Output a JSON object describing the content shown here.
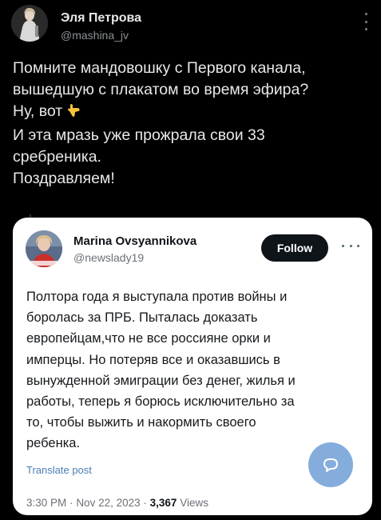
{
  "author": {
    "name": "Эля Петрова",
    "handle": "@mashina_jv"
  },
  "post": {
    "lines": [
      "Помните мандовошку с Первого канала,",
      "вышедшую с плакатом во время эфира?",
      "Ну, вот",
      "И эта мразь уже прожрала свои 33",
      "сребреника.",
      "Поздравляем!"
    ],
    "emoji": "pointing-down-hand-icon"
  },
  "quoted": {
    "name": "Marina Ovsyannikova",
    "handle": "@newslady19",
    "follow_label": "Follow",
    "lines": [
      "Полтора года я выступала против войны и",
      "боролась за ПРБ. Пыталась доказать",
      "европейцам,что не все россияне орки и",
      "имперцы. Но потеряв все и оказавшись в",
      "вынужденной эмиграции без денег, жилья и",
      "работы, теперь я борюсь исключительно за",
      "то, чтобы выжить и накормить своего",
      "ребенка."
    ],
    "translate_label": "Translate post",
    "time": "3:30 PM",
    "separator": "·",
    "date": "Nov 22, 2023",
    "views_count": "3,367",
    "views_label": "Views"
  },
  "colors": {
    "background": "#000000",
    "card": "#ffffff",
    "follow_button": "#0f1419",
    "link": "#4a7fb5",
    "reply_fab": "#6f9fd6"
  }
}
